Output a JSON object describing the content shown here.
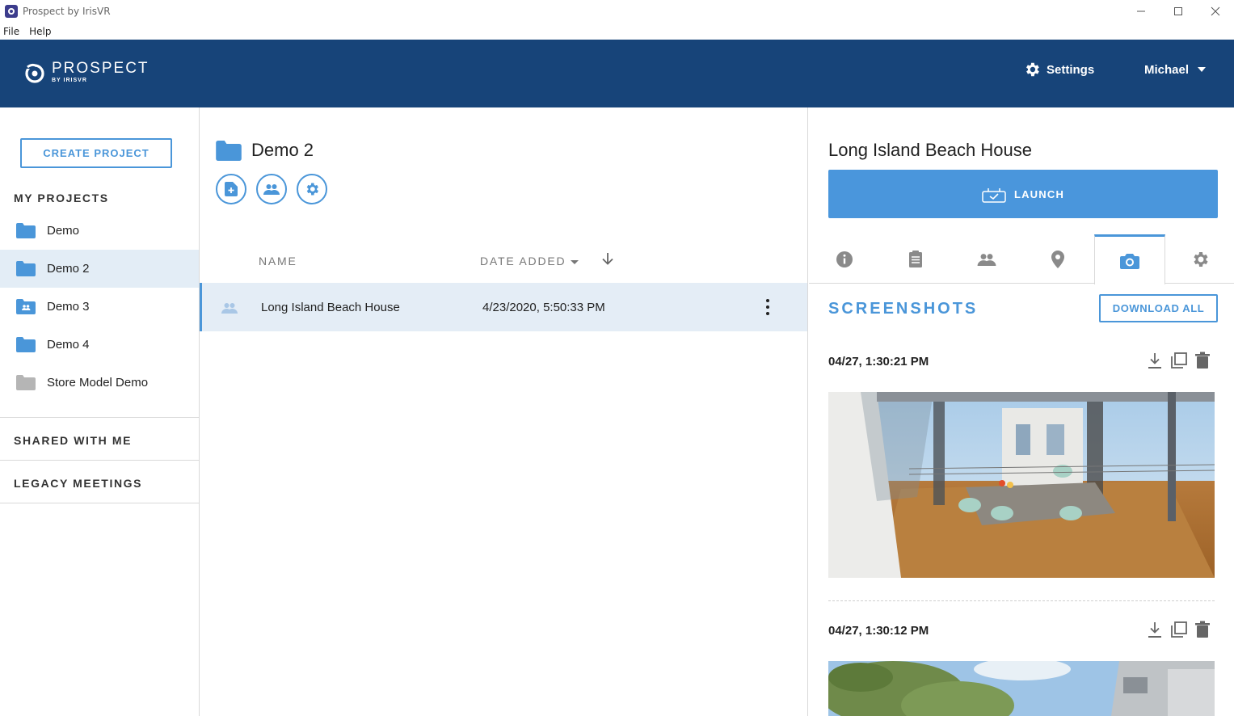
{
  "window": {
    "title": "Prospect by IrisVR"
  },
  "menu": {
    "file": "File",
    "help": "Help"
  },
  "header": {
    "logo_main": "PROSPECT",
    "logo_sub": "BY IRISVR",
    "settings_label": "Settings",
    "user_name": "Michael"
  },
  "sidebar": {
    "create_label": "CREATE PROJECT",
    "my_projects_label": "MY PROJECTS",
    "projects": [
      {
        "label": "Demo",
        "icon": "folder-icon",
        "color": "#4a96d9"
      },
      {
        "label": "Demo 2",
        "icon": "folder-icon",
        "color": "#4a96d9",
        "active": true
      },
      {
        "label": "Demo 3",
        "icon": "shared-folder-icon",
        "color": "#4a96d9"
      },
      {
        "label": "Demo 4",
        "icon": "folder-icon",
        "color": "#4a96d9"
      },
      {
        "label": "Store Model Demo",
        "icon": "folder-icon",
        "color": "#b5b5b5"
      }
    ],
    "shared_label": "SHARED WITH ME",
    "legacy_label": "LEGACY MEETINGS"
  },
  "folder": {
    "name": "Demo 2",
    "columns": {
      "name": "NAME",
      "date": "DATE ADDED"
    },
    "files": [
      {
        "name": "Long Island Beach House",
        "date": "4/23/2020, 5:50:33 PM"
      }
    ]
  },
  "detail": {
    "title": "Long Island Beach House",
    "launch_label": "LAUNCH",
    "tabs": [
      "info-icon",
      "notes-icon",
      "people-icon",
      "location-icon",
      "camera-icon",
      "gear-icon"
    ],
    "active_tab": "camera-icon",
    "screenshots_label": "SCREENSHOTS",
    "download_all_label": "DOWNLOAD ALL",
    "screenshots": [
      {
        "time": "04/27, 1:30:21 PM"
      },
      {
        "time": "04/27, 1:30:12 PM"
      }
    ]
  },
  "colors": {
    "header": "#174479",
    "accent": "#4a96d9",
    "selected_row": "#e4edf6"
  }
}
